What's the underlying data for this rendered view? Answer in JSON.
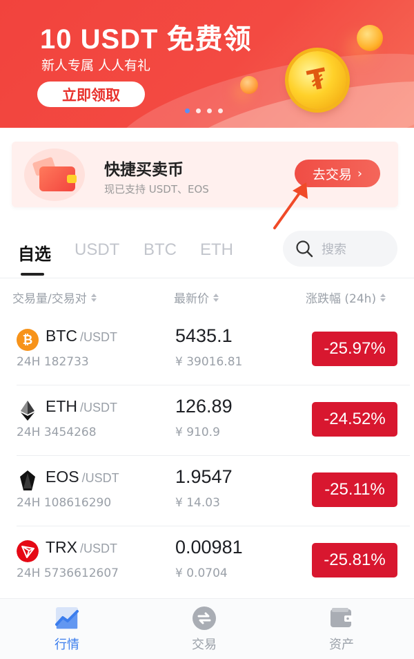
{
  "banner": {
    "title": "10 USDT 免费领",
    "subtitle": "新人专属  人人有礼",
    "cta": "立即领取",
    "coin_symbol": "₮",
    "dots": [
      true,
      false,
      false,
      false
    ]
  },
  "quick_trade": {
    "title": "快捷买卖币",
    "subtitle": "现已支持 USDT、EOS",
    "button": "去交易",
    "chevron": "›"
  },
  "tabs": [
    {
      "label": "自选",
      "active": true
    },
    {
      "label": "USDT",
      "active": false
    },
    {
      "label": "BTC",
      "active": false
    },
    {
      "label": "ETH",
      "active": false
    }
  ],
  "search": {
    "placeholder": "搜索"
  },
  "columns": {
    "pair": "交易量/交易对",
    "price": "最新价",
    "change": "涨跌幅 (24h)"
  },
  "rows": [
    {
      "base": "BTC",
      "quote": "/USDT",
      "volume": "24H 182733",
      "price": "5435.1",
      "cny": "¥ 39016.81",
      "change": "-25.97%",
      "icon": "bitcoin-icon",
      "icon_glyph": "₿",
      "icon_color": "#f7931a"
    },
    {
      "base": "ETH",
      "quote": "/USDT",
      "volume": "24H 3454268",
      "price": "126.89",
      "cny": "¥ 910.9",
      "change": "-24.52%",
      "icon": "ethereum-icon",
      "icon_glyph": "◆",
      "icon_color": "#ffffff"
    },
    {
      "base": "EOS",
      "quote": "/USDT",
      "volume": "24H 108616290",
      "price": "1.9547",
      "cny": "¥ 14.03",
      "change": "-25.11%",
      "icon": "eos-icon",
      "icon_glyph": "⬢",
      "icon_color": "#ffffff"
    },
    {
      "base": "TRX",
      "quote": "/USDT",
      "volume": "24H 5736612607",
      "price": "0.00981",
      "cny": "¥ 0.0704",
      "change": "-25.81%",
      "icon": "tron-icon",
      "icon_glyph": "▽",
      "icon_color": "#e50915"
    }
  ],
  "nav": [
    {
      "label": "行情",
      "icon": "market-chart-icon",
      "active": true
    },
    {
      "label": "交易",
      "icon": "exchange-icon",
      "active": false
    },
    {
      "label": "资产",
      "icon": "wallet-icon",
      "active": false
    }
  ],
  "colors": {
    "accent": "#3b7ded",
    "down": "#d8172f",
    "banner": "#f2433d"
  }
}
